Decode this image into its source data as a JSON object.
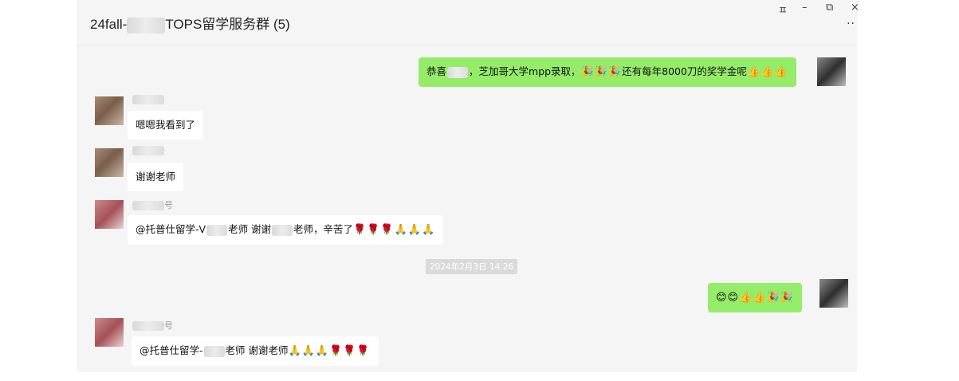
{
  "window": {
    "title_prefix": "24fall-",
    "title_suffix": "TOPS留学服务群 (5)",
    "controls": {
      "pin": "ㅍ",
      "minimize": "–",
      "restore": "⧉",
      "close": "×"
    },
    "more": "··"
  },
  "messages": [
    {
      "id": "m1",
      "side": "out",
      "parts": [
        "恭喜",
        "，芝加哥大学mpp录取，",
        "🎉🎉🎉",
        "还有每年8000刀的奖学金呢",
        "👍👍👍"
      ]
    },
    {
      "id": "m2",
      "side": "in",
      "text": "嗯嗯我看到了"
    },
    {
      "id": "m3",
      "side": "in",
      "text": "谢谢老师"
    },
    {
      "id": "m4",
      "side": "in",
      "parts": [
        "@托普仕留学-V",
        "老师 谢谢",
        "老师，辛苦了",
        "🌹🌹🌹🙏🙏🙏"
      ]
    },
    {
      "id": "m5",
      "side": "out",
      "emoji": "😊😊👍👍🎉🎉"
    },
    {
      "id": "m6",
      "side": "in",
      "parts": [
        "@托普仕留学-",
        "老师 谢谢老师",
        "🙏🙏🙏🌹🌹🌹"
      ]
    }
  ],
  "timestamp": "2024年2月3日 14:26",
  "sender_name_suffix": "号"
}
